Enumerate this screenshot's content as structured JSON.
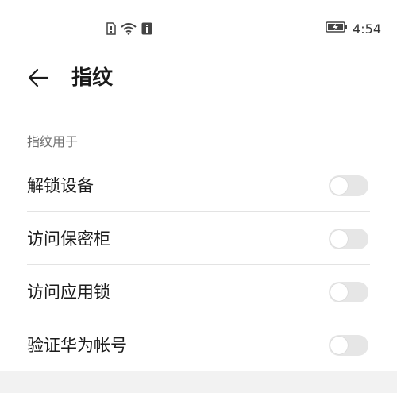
{
  "status_bar": {
    "time": "4:54",
    "icons": [
      "sim-icon",
      "wifi-icon",
      "notification-icon",
      "battery-charging-icon"
    ]
  },
  "header": {
    "title": "指纹"
  },
  "section": {
    "label": "指纹用于"
  },
  "items": [
    {
      "label": "解锁设备",
      "enabled": false
    },
    {
      "label": "访问保密柜",
      "enabled": false
    },
    {
      "label": "访问应用锁",
      "enabled": false
    },
    {
      "label": "验证华为帐号",
      "enabled": false
    }
  ],
  "colors": {
    "toggle_off": "#e6e6e6",
    "title": "#1b1b1b",
    "section_label": "#707070"
  }
}
